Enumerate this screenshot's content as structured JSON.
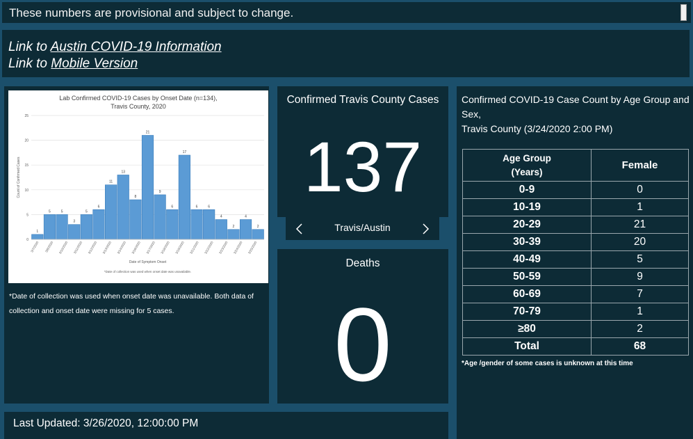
{
  "banner": {
    "text": "These numbers are provisional and subject to change."
  },
  "links": [
    {
      "prefix": "Link to ",
      "link_text": "Austin COVID-19 Information"
    },
    {
      "prefix": "Link to ",
      "link_text": "Mobile Version"
    }
  ],
  "epi": {
    "note": "*Date of collection was used when onset date was unavailable.  Both data of collection and onset date were missing for 5 cases."
  },
  "chart_data": {
    "type": "bar",
    "title": "Lab Confirmed COVID-19 Cases by Onset Date (n=134), Travis County, 2020",
    "xlabel": "Date of Symptom Onset",
    "ylabel": "Count of Confirmed Cases",
    "footnote": "*Date of collection was used when onset date was unavailable.",
    "ylim": [
      0,
      25
    ],
    "yticks": [
      0,
      5,
      10,
      15,
      20,
      25
    ],
    "categories": [
      "3/7/2020",
      "3/8/2020",
      "3/9/2020",
      "3/10/2020",
      "3/11/2020",
      "3/12/2020",
      "3/13/2020",
      "3/14/2020",
      "3/15/2020",
      "3/16/2020",
      "3/17/2020",
      "3/18/2020",
      "3/19/2020",
      "3/20/2020",
      "3/21/2020",
      "3/22/2020",
      "3/23/2020",
      "3/24/2020",
      "3/25/2020"
    ],
    "tick_labels": [
      "3/7/2020",
      "3/8/2020",
      "3/10/2020",
      "3/11/2020",
      "3/12/2020",
      "3/13/2020",
      "3/14/2020",
      "3/16/2020",
      "3/17/2020",
      "3/18/2020",
      "3/19/2020",
      "3/21/2020",
      "3/22/2020",
      "3/23/2020",
      "3/24/2020",
      "3/25/2020"
    ],
    "values": [
      1,
      5,
      5,
      3,
      5,
      6,
      11,
      13,
      8,
      21,
      9,
      6,
      17,
      6,
      6,
      4,
      2,
      4,
      2
    ],
    "bar_color": "#5b9bd5",
    "grid": true
  },
  "cases": {
    "title": "Confirmed Travis County Cases",
    "value": "137",
    "nav_label": "Travis/Austin"
  },
  "deaths": {
    "title": "Deaths",
    "value": "0"
  },
  "updated": {
    "text": "Last Updated: 3/26/2020, 12:00:00 PM"
  },
  "agesex": {
    "title_line1": "Confirmed COVID-19 Case Count by Age Group and Sex,",
    "title_line2": "Travis County (3/24/2020 2:00 PM)",
    "col_age_line1": "Age Group",
    "col_age_line2": "(Years)",
    "col_female": "Female",
    "rows": [
      {
        "group": "0-9",
        "female": "0"
      },
      {
        "group": "10-19",
        "female": "1"
      },
      {
        "group": "20-29",
        "female": "21"
      },
      {
        "group": "30-39",
        "female": "20"
      },
      {
        "group": "40-49",
        "female": "5"
      },
      {
        "group": "50-59",
        "female": "9"
      },
      {
        "group": "60-69",
        "female": "7"
      },
      {
        "group": "70-79",
        "female": "1"
      },
      {
        "group": "≥80",
        "female": "2"
      }
    ],
    "total_label": "Total",
    "total_value": "68",
    "footnote": "*Age /gender of some cases is unknown at this time"
  },
  "colors": {
    "background": "#1b4f6b",
    "panel": "#0d2b36",
    "text": "#ffffff"
  }
}
